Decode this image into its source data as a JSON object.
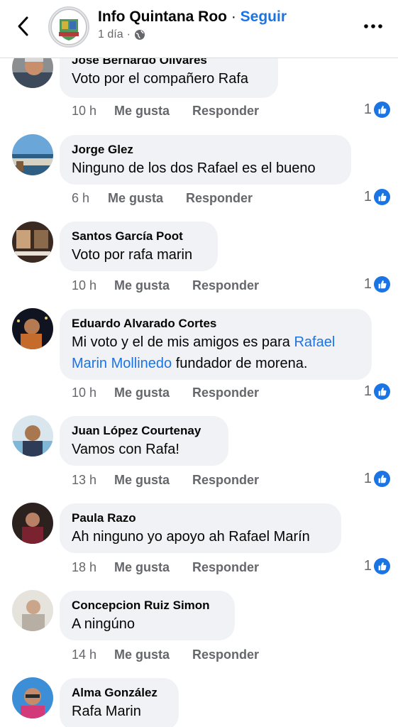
{
  "header": {
    "page_name": "Info Quintana Roo",
    "separator": "·",
    "follow_label": "Seguir",
    "time": "1 día",
    "meta_separator": "·"
  },
  "comments": [
    {
      "author": "Jose Bernardo Olivares",
      "text": "Voto por el compañero Rafa",
      "time": "10 h",
      "like_label": "Me gusta",
      "reply_label": "Responder",
      "reactions": "1"
    },
    {
      "author": "Jorge Glez",
      "text": "Ninguno de los dos Rafael es el bueno",
      "time": "6 h",
      "like_label": "Me gusta",
      "reply_label": "Responder",
      "reactions": "1"
    },
    {
      "author": "Santos García Poot",
      "text": "Voto por rafa marin",
      "time": "10 h",
      "like_label": "Me gusta",
      "reply_label": "Responder",
      "reactions": "1"
    },
    {
      "author": "Eduardo Alvarado Cortes",
      "text_before": "Mi voto y el de mis amigos es para ",
      "mention": "Rafael Marin Mollinedo",
      "text_after": " fundador de morena.",
      "time": "10 h",
      "like_label": "Me gusta",
      "reply_label": "Responder",
      "reactions": "1"
    },
    {
      "author": "Juan López Courtenay",
      "text": "Vamos con Rafa!",
      "time": "13 h",
      "like_label": "Me gusta",
      "reply_label": "Responder",
      "reactions": "1"
    },
    {
      "author": "Paula Razo",
      "text": "Ah ninguno yo apoyo ah Rafael Marín",
      "time": "18 h",
      "like_label": "Me gusta",
      "reply_label": "Responder",
      "reactions": "1"
    },
    {
      "author": "Concepcion Ruiz Simon",
      "text": "A ningúno",
      "time": "14 h",
      "like_label": "Me gusta",
      "reply_label": "Responder"
    },
    {
      "author": "Alma González",
      "text": "Rafa Marin"
    }
  ],
  "colors": {
    "accent": "#1b74e4",
    "bubble": "#f0f2f5",
    "secondary_text": "#65676b"
  },
  "icons": {
    "back": "chevron-left-icon",
    "privacy": "globe-icon",
    "more": "more-options-icon",
    "reaction": "thumbs-up-icon"
  }
}
